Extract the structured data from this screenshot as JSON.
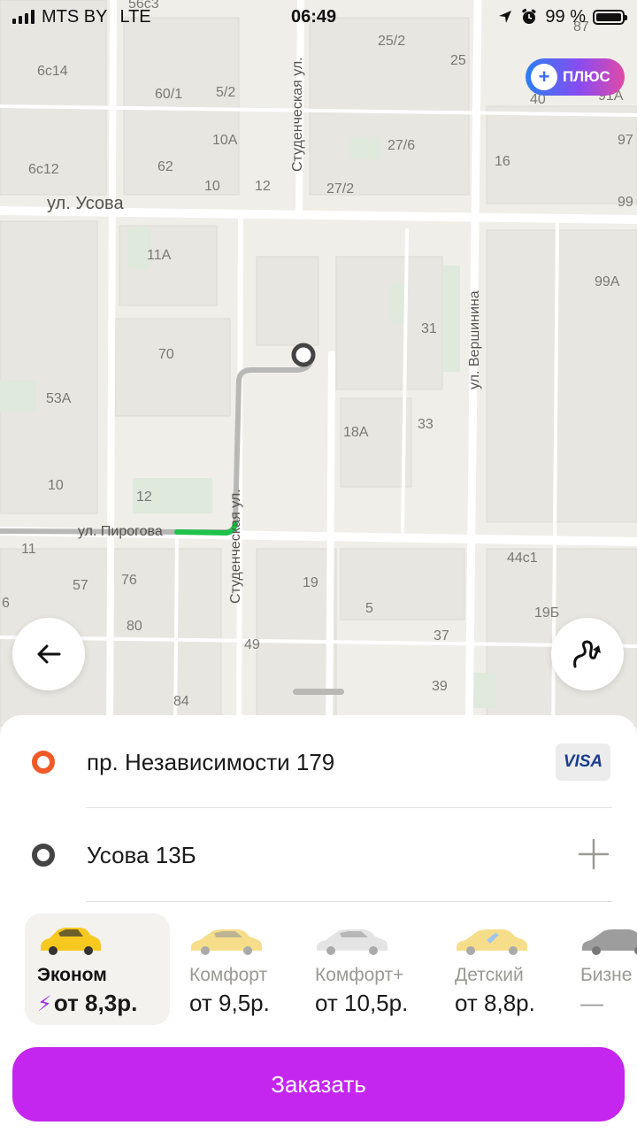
{
  "status_bar": {
    "carrier": "MTS BY",
    "network": "LTE",
    "time": "06:49",
    "battery": "99 %",
    "battery_level": 0.99
  },
  "plus_badge": {
    "label": "ПЛЮС"
  },
  "map": {
    "streets": {
      "usova": "ул. Усова",
      "studencheskaya_top": "Студенческая ул.",
      "studencheskaya_bottom": "Студенческая ул.",
      "vershinina": "ул. Вершинина",
      "pirogova": "ул. Пирогова"
    },
    "buildings": [
      "56с3",
      "25/2",
      "87",
      "6с14",
      "60/1",
      "5/2",
      "25",
      "40",
      "91А",
      "10А",
      "27/6",
      "97",
      "6с12",
      "62",
      "10",
      "12",
      "27/2",
      "16",
      "99",
      "11А",
      "99А",
      "31",
      "70",
      "53А",
      "18А",
      "33",
      "10",
      "12",
      "11",
      "57",
      "76",
      "19",
      "5",
      "44с1",
      "6",
      "80",
      "19Б",
      "49",
      "37",
      "39",
      "84"
    ]
  },
  "route": {
    "from": "пр. Независимости 179",
    "to": "Усова 13Б",
    "payment": "VISA"
  },
  "tariffs": [
    {
      "name": "Эконом",
      "price": "от 8,3р.",
      "selected": true
    },
    {
      "name": "Комфорт",
      "price": "от 9,5р.",
      "selected": false
    },
    {
      "name": "Комфорт+",
      "price": "от 10,5р.",
      "selected": false
    },
    {
      "name": "Детский",
      "price": "от 8,8р.",
      "selected": false
    },
    {
      "name": "Бизне",
      "price": "—",
      "selected": false
    }
  ],
  "order_button": {
    "label": "Заказать"
  },
  "colors": {
    "accent": "#c425ef",
    "origin_dot": "#f05a28",
    "destination_dot": "#444444",
    "route_gray": "#b8b8b6",
    "route_green": "#1fc24a"
  }
}
